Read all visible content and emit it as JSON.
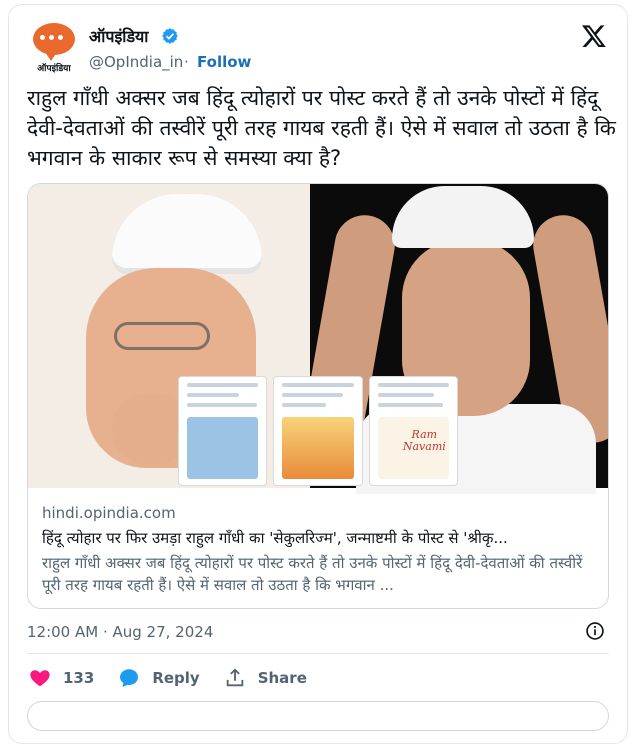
{
  "account": {
    "logo_wordmark": "ऑपइंडिया",
    "name": "ऑपइंडिया",
    "handle": "@OpIndia_in",
    "separator": "·",
    "follow_label": "Follow",
    "verified_icon": "verified-badge-icon",
    "logo_color": "#ea6a2e",
    "brand_logo": "x-logo-icon"
  },
  "tweet": {
    "text": "राहुल गाँधी अक्सर जब हिंदू त्योहारों पर पोस्ट करते हैं तो उनके पोस्टों में हिंदू देवी-देवताओं की तस्वीरें पूरी तरह गायब रहती हैं। ऐसे में सवाल तो उठता है कि भगवान के साकार रूप से समस्या क्या है?",
    "timestamp": "12:00 AM · Aug 27, 2024"
  },
  "link_card": {
    "domain": "hindi.opindia.com",
    "title": "हिंदू त्योहार पर फिर उमड़ा राहुल गाँधी का 'सेकुलरिज्म', जन्माष्टमी के पोस्ट से 'श्रीकृ...",
    "description": "राहुल गाँधी अक्सर जब हिंदू त्योहारों पर पोस्ट करते हैं तो उनके पोस्टों में हिंदू देवी-देवताओं की तस्वीरें पूरी तरह गायब रहती हैं। ऐसे में सवाल तो उठता है कि भगवान ...",
    "image_overlay_text": "Ram Navami"
  },
  "actions": {
    "like_count": "133",
    "reply_label": "Reply",
    "share_label": "Share",
    "like_color": "#f91880",
    "reply_color": "#1d9bf0"
  }
}
